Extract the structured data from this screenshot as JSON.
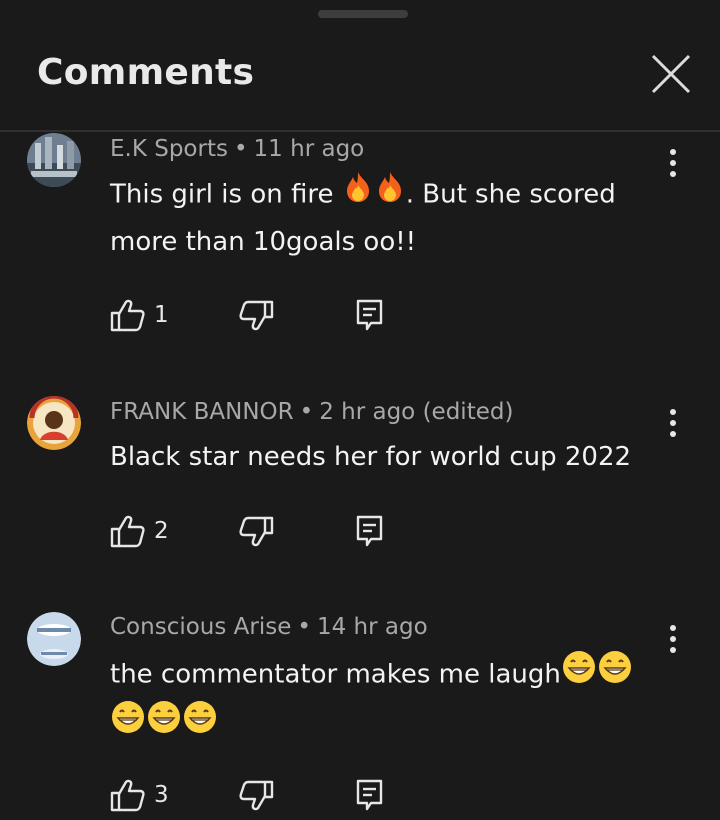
{
  "panel": {
    "title": "Comments"
  },
  "comments": [
    {
      "author": "E.K Sports",
      "age": "11 hr ago",
      "edited": "",
      "text_part1": "This girl is on fire",
      "text_part2": ". But she scored more than 10goals oo!!",
      "likes": "1"
    },
    {
      "author": "FRANK BANNOR",
      "age": "2 hr ago",
      "edited": "(edited)",
      "text_part1": "Black star needs her for world cup 2022",
      "likes": "2"
    },
    {
      "author": "Conscious Arise",
      "age": "14 hr ago",
      "edited": "",
      "text_part1": "the commentator makes me laugh",
      "likes": "3"
    }
  ],
  "icons": {
    "close": "close-icon",
    "more": "more-vertical-icon",
    "like": "thumbs-up-icon",
    "dislike": "thumbs-down-icon",
    "reply": "reply-icon",
    "fire": "fire-emoji",
    "grin": "grinning-emoji"
  },
  "colors": {
    "background": "#1a1a1a",
    "text_primary": "#f3f3f3",
    "text_secondary": "#a8a8a8",
    "divider": "#2f2f2f"
  }
}
